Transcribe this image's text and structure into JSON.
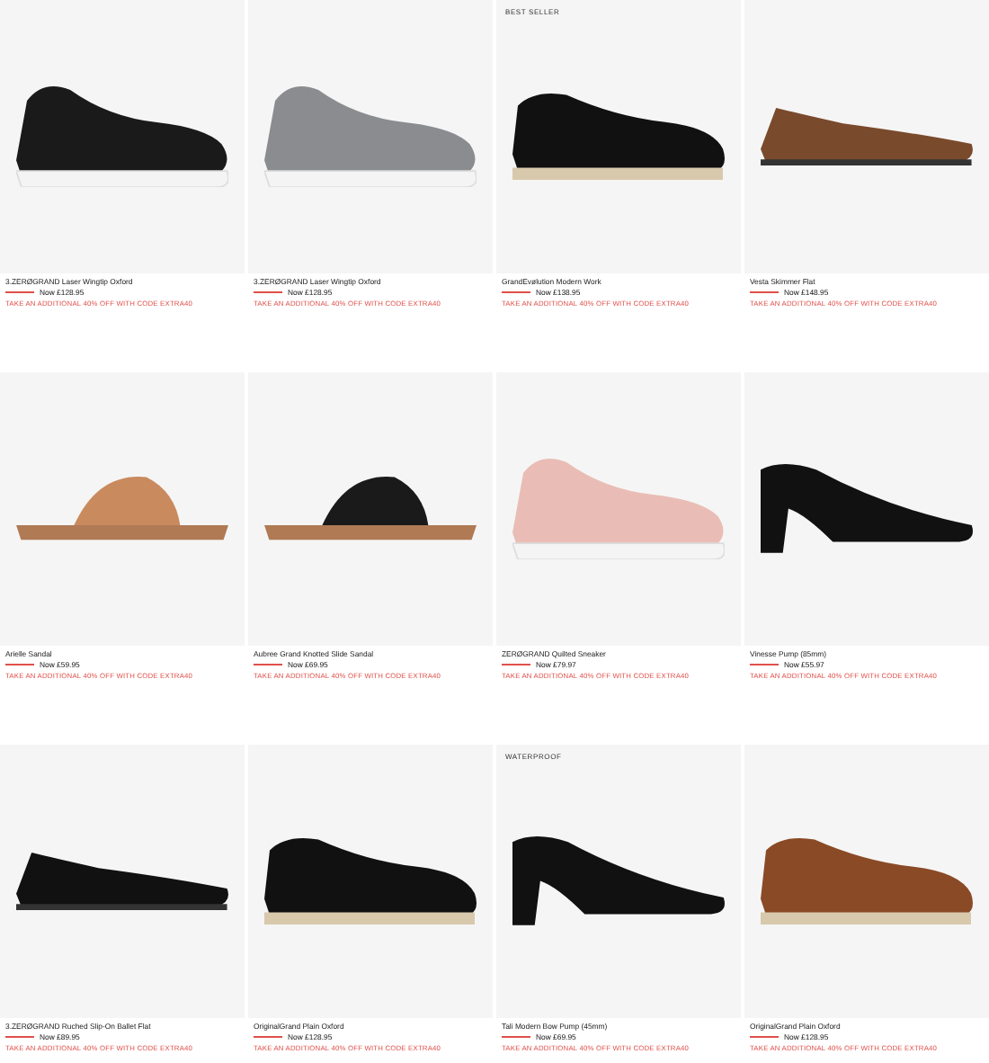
{
  "products": [
    {
      "name": "3.ZERØGRAND Laser Wingtip Oxford",
      "price": "Now £128.95",
      "promo": "TAKE AN ADDITIONAL 40% OFF WITH CODE EXTRA40",
      "kind": "sneaker",
      "color": "#1a1a1a"
    },
    {
      "name": "3.ZERØGRAND Laser Wingtip Oxford",
      "price": "Now £128.95",
      "promo": "TAKE AN ADDITIONAL 40% OFF WITH CODE EXTRA40",
      "kind": "sneaker",
      "color": "#8a8c90"
    },
    {
      "badge": "BEST SELLER",
      "name": "GrandEvølution Modern Work",
      "price": "Now £138.95",
      "promo": "TAKE AN ADDITIONAL 40% OFF WITH CODE EXTRA40",
      "kind": "oxford",
      "color": "#111111"
    },
    {
      "name": "Vesta Skimmer Flat",
      "price": "Now £148.95",
      "promo": "TAKE AN ADDITIONAL 40% OFF WITH CODE EXTRA40",
      "kind": "flat",
      "color": "#7a4a2c"
    },
    {
      "name": "Arielle Sandal",
      "price": "Now £59.95",
      "promo": "TAKE AN ADDITIONAL 40% OFF WITH CODE EXTRA40",
      "kind": "sandal",
      "color": "#c98a5e"
    },
    {
      "name": "Aubree Grand Knotted Slide Sandal",
      "price": "Now £69.95",
      "promo": "TAKE AN ADDITIONAL 40% OFF WITH CODE EXTRA40",
      "kind": "sandal",
      "color": "#1a1a1a"
    },
    {
      "name": "ZERØGRAND Quilted Sneaker",
      "price": "Now £79.97",
      "promo": "TAKE AN ADDITIONAL 40% OFF WITH CODE EXTRA40",
      "kind": "sneaker",
      "color": "#e9bdb5"
    },
    {
      "name": "Vinesse Pump (85mm)",
      "price": "Now £55.97",
      "promo": "TAKE AN ADDITIONAL 40% OFF WITH CODE EXTRA40",
      "kind": "pump",
      "color": "#111111"
    },
    {
      "name": "3.ZERØGRAND Ruched Slip-On Ballet Flat",
      "price": "Now £89.95",
      "promo": "TAKE AN ADDITIONAL 40% OFF WITH CODE EXTRA40",
      "kind": "flat",
      "color": "#111111"
    },
    {
      "name": "OriginalGrand Plain Oxford",
      "price": "Now £128.95",
      "promo": "TAKE AN ADDITIONAL 40% OFF WITH CODE EXTRA40",
      "kind": "oxford",
      "color": "#111111"
    },
    {
      "badge": "WATERPROOF",
      "name": "Tali Modern Bow Pump (45mm)",
      "price": "Now £69.95",
      "promo": "TAKE AN ADDITIONAL 40% OFF WITH CODE EXTRA40",
      "kind": "pump",
      "color": "#111111"
    },
    {
      "name": "OriginalGrand Plain Oxford",
      "price": "Now £128.95",
      "promo": "TAKE AN ADDITIONAL 40% OFF WITH CODE EXTRA40",
      "kind": "oxford",
      "color": "#8a4a26"
    }
  ]
}
